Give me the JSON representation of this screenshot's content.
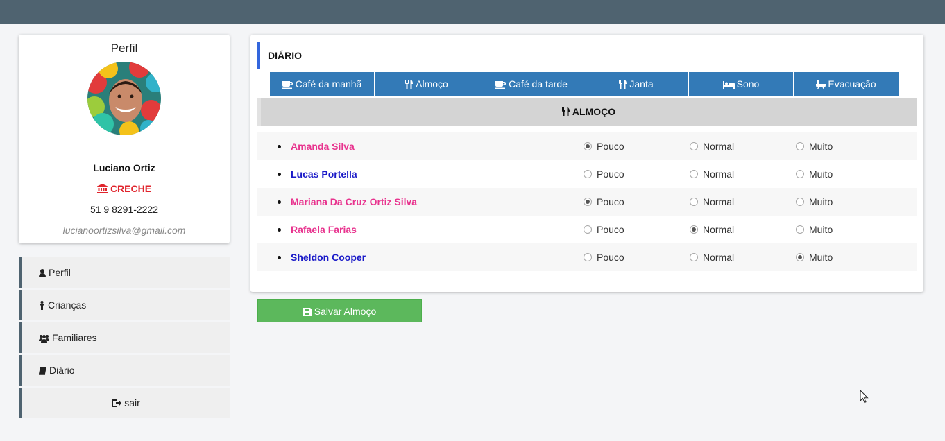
{
  "profile": {
    "title": "Perfil",
    "name": "Luciano Ortiz",
    "org": "CRECHE",
    "phone": "51 9 8291-2222",
    "email": "lucianoortizsilva@gmail.com"
  },
  "nav": {
    "items": [
      {
        "label": "Perfil",
        "icon": "user-icon"
      },
      {
        "label": "Crianças",
        "icon": "child-icon"
      },
      {
        "label": "Familiares",
        "icon": "users-icon"
      },
      {
        "label": "Diário",
        "icon": "book-icon"
      },
      {
        "label": "sair",
        "icon": "sign-out-icon"
      }
    ]
  },
  "panel": {
    "header": "DIÁRIO",
    "tabs": [
      {
        "label": "Café da manhã",
        "icon": "coffee-icon"
      },
      {
        "label": "Almoço",
        "icon": "cutlery-icon"
      },
      {
        "label": "Café da tarde",
        "icon": "coffee-icon"
      },
      {
        "label": "Janta",
        "icon": "cutlery-icon"
      },
      {
        "label": "Sono",
        "icon": "bed-icon"
      },
      {
        "label": "Evacuação",
        "icon": "bath-icon"
      }
    ],
    "section_title": "ALMOÇO",
    "options": [
      "Pouco",
      "Normal",
      "Muito"
    ],
    "children": [
      {
        "name": "Amanda Silva",
        "gender": "girl",
        "selected": "Pouco"
      },
      {
        "name": "Lucas Portella",
        "gender": "boy",
        "selected": ""
      },
      {
        "name": "Mariana Da Cruz Ortiz Silva",
        "gender": "girl",
        "selected": "Pouco"
      },
      {
        "name": "Rafaela Farias",
        "gender": "girl",
        "selected": "Normal"
      },
      {
        "name": "Sheldon Cooper",
        "gender": "boy",
        "selected": "Muito"
      }
    ]
  },
  "save_button": {
    "label": "Salvar Almoço",
    "icon": "save-icon"
  },
  "colors": {
    "topbar": "#4f6370",
    "tab_blue": "#337ab7",
    "save_green": "#5cb85c",
    "girl_name": "#e8338e",
    "boy_name": "#1a1ac8",
    "org_red": "#e0242c",
    "header_accent": "#3366dd"
  }
}
